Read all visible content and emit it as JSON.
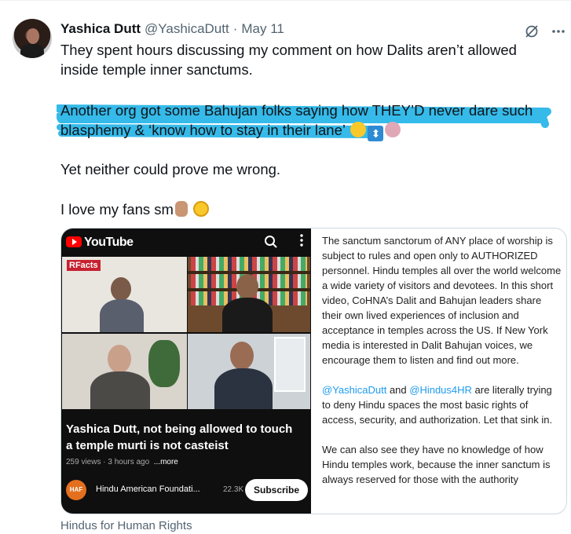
{
  "tweet": {
    "author_name": "Yashica Dutt",
    "handle": "@YashicaDutt",
    "separator": "·",
    "date": "May 11",
    "paragraph1": "They spent hours discussing my comment on how Dalits aren’t allowed inside temple inner sanctums.",
    "paragraph2": "Another org got some Bahujan folks saying how THEY’D never dare such blasphemy & ‘know how to stay in their lane’",
    "paragraph3": "Yet neither could prove me wrong.",
    "paragraph4": "I love my fans sm",
    "highlight_color": "#2ab6e8"
  },
  "icons": {
    "grok": "grok-icon",
    "more": "more-icon",
    "emoji_p2": [
      "slightly-smiling-face-emoji",
      "up-down-arrow-emoji",
      "person-gesturing-no-emoji"
    ],
    "emoji_p4": [
      "pinched-fingers-emoji",
      "holding-back-tears-emoji"
    ]
  },
  "video": {
    "platform": "YouTube",
    "overlay_badge": "RFacts",
    "title": "Yashica Dutt, not being allowed to touch a temple murti is not casteist",
    "views": "259 views",
    "age": "3 hours ago",
    "more_label": "...more",
    "channel_logo_text": "HAF",
    "channel_name": "Hindu American Foundati...",
    "subscribers": "22.3K",
    "subscribe_label": "Subscribe"
  },
  "post": {
    "p1": "The sanctum sanctorum of ANY place of worship is subject to rules and open only to AUTHORIZED personnel. Hindu temples all over the world welcome a wide variety of visitors and devotees. In this short video, CoHNA’s Dalit and Bahujan leaders share their own lived experiences of inclusion and acceptance in temples across the US. If New York media is interested in Dalit Bahujan voices, we encourage them to listen and find out more.",
    "mention1": "@YashicaDutt",
    "and_word": " and ",
    "mention2": "@Hindus4HR",
    "p2_rest": " are literally trying to deny Hindu spaces the most basic rights of access, security, and authorization. Let that sink in.",
    "p3": "We can also see they have no knowledge of how Hindu temples work, because the inner sanctum is always reserved for those with the authority"
  },
  "caption": "Hindus for Human Rights"
}
